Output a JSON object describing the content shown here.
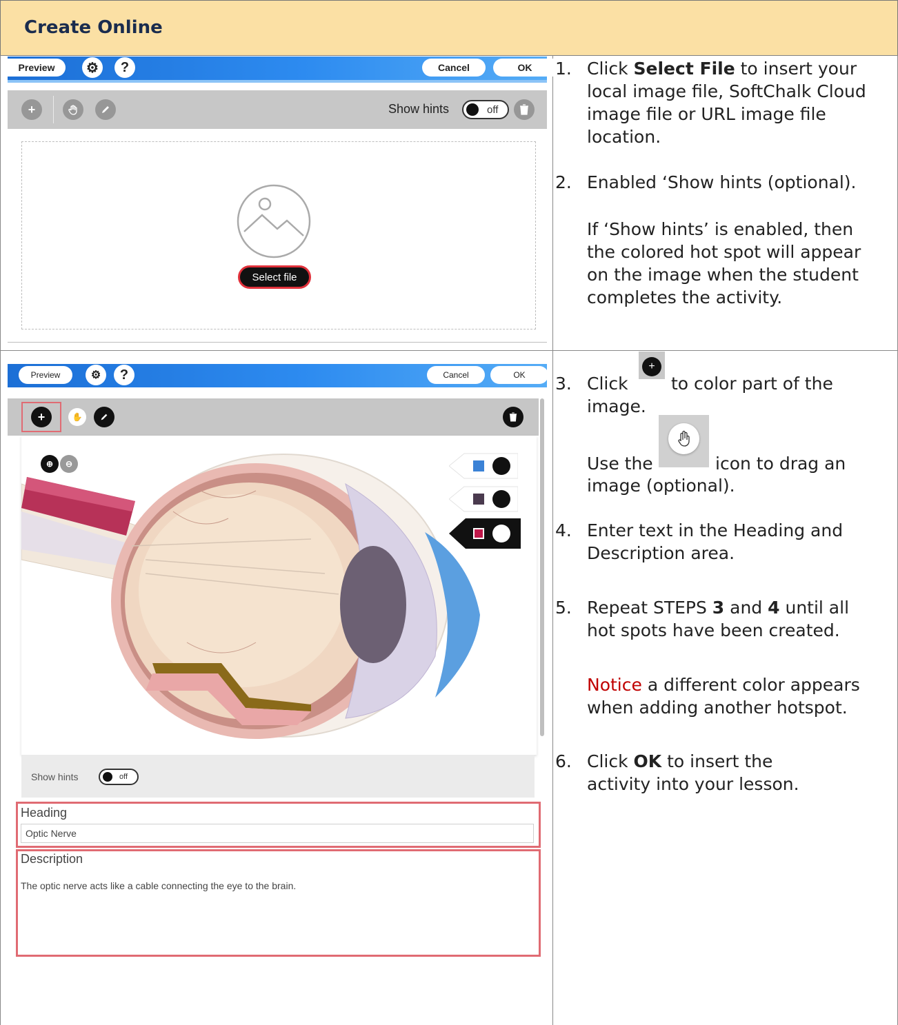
{
  "title": "Create Online",
  "panel1": {
    "toolbar": {
      "preview": "Preview",
      "settings_icon": "gear-icon",
      "help": "?",
      "cancel": "Cancel",
      "ok": "OK"
    },
    "graybar": {
      "show_hints": "Show hints",
      "toggle_state": "off"
    },
    "select_file": "Select file"
  },
  "panel2": {
    "toolbar": {
      "preview": "Preview",
      "help": "?",
      "cancel": "Cancel",
      "ok": "OK"
    },
    "show_hints": "Show hints",
    "toggle_state": "off",
    "hotspot_colors": [
      "#3b82d6",
      "#4a3a4e",
      "#c0184a"
    ],
    "heading_label": "Heading",
    "heading_value": "Optic Nerve",
    "description_label": "Description",
    "description_value": "The optic nerve acts like a cable connecting the eye to the brain."
  },
  "steps": {
    "s1_num": "1.",
    "s1_a": "Click ",
    "s1_b": "Select File",
    "s1_c": " to insert your",
    "s1_l2": "local image file, SoftChalk Cloud",
    "s1_l3": "image file or URL image file",
    "s1_l4": "location.",
    "s2_num": "2.",
    "s2_l1": "Enabled ‘Show hints (optional).",
    "s2_p1": "If ‘Show hints’ is enabled, then",
    "s2_p2": "the colored hot spot will appear",
    "s2_p3": "on the image when the student",
    "s2_p4": "completes the activity.",
    "s3_num": "3.",
    "s3_a": "Click",
    "s3_b": "to color part of the",
    "s3_l2": "image.",
    "s3_use": "Use the",
    "s3_icon": "icon to drag an",
    "s3_l4": "image (optional).",
    "s4_num": "4.",
    "s4_l1": "Enter text in the Heading and",
    "s4_l2": "Description area.",
    "s5_num": "5.",
    "s5_a": "Repeat STEPS ",
    "s5_b": "3",
    "s5_c": " and ",
    "s5_d": "4",
    "s5_e": " until all",
    "s5_l2": "hot spots have been created.",
    "notice": "Notice",
    "notice_rest": " a different color appears",
    "notice_l2": "when adding another hotspot.",
    "s6_num": "6.",
    "s6_a": "Click ",
    "s6_b": "OK",
    "s6_c": " to insert the",
    "s6_l2": "activity into your lesson."
  }
}
